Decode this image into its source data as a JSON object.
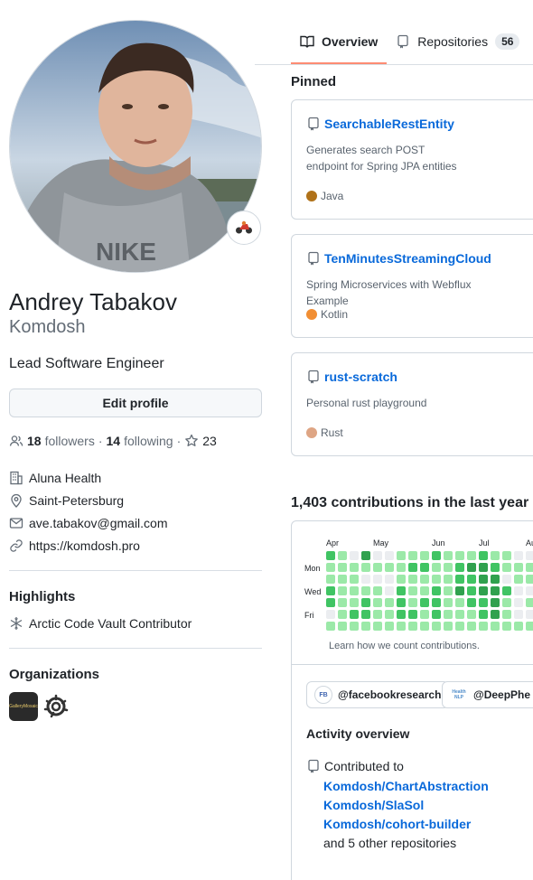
{
  "tabs": [
    {
      "label": "Overview",
      "icon": "book-icon",
      "active": true
    },
    {
      "label": "Repositories",
      "icon": "repo-icon",
      "count": "56"
    }
  ],
  "profile": {
    "name": "Andrey Tabakov",
    "login": "Komdosh",
    "bio": "Lead Software Engineer",
    "edit_label": "Edit profile",
    "followers_count": "18",
    "followers_label": "followers",
    "separator": "·",
    "following_count": "14",
    "following_label": "following",
    "stars_count": "23",
    "company": "Aluna Health",
    "location": "Saint-Petersburg",
    "email": "ave.tabakov@gmail.com",
    "website": "https://komdosh.pro"
  },
  "highlights": {
    "heading": "Highlights",
    "items": [
      "Arctic Code Vault Contributor"
    ]
  },
  "organizations": {
    "heading": "Organizations",
    "items": [
      {
        "name": "GalleryMosaic",
        "logo_text": "GalleryMosaic",
        "icon": "org-gallery-icon"
      },
      {
        "name": "grafana",
        "icon": "grafana-icon"
      }
    ]
  },
  "pinned": {
    "heading": "Pinned",
    "items": [
      {
        "name": "SearchableRestEntity",
        "description_lines": [
          "Generates search POST",
          "endpoint for Spring JPA entities"
        ],
        "language": "Java",
        "language_color": "#b07219"
      },
      {
        "name": "TenMinutesStreamingCloud",
        "description_lines": [
          "Spring Microservices with Webflux Example"
        ],
        "language": "Kotlin",
        "language_color": "#F18E33"
      },
      {
        "name": "rust-scratch",
        "description_lines": [
          "Personal rust playground"
        ],
        "language": "Rust",
        "language_color": "#dea584"
      }
    ]
  },
  "contributions": {
    "heading": "1,403 contributions in the last year",
    "months": [
      "Apr",
      "May",
      "Jun",
      "Jul",
      "Au"
    ],
    "weekdays": [
      "Mon",
      "Wed",
      "Fri"
    ],
    "levels": [
      [
        2,
        1,
        1,
        2,
        2,
        0
      ],
      [
        1,
        1,
        1,
        1,
        1,
        1
      ],
      [
        0,
        1,
        1,
        1,
        1,
        2
      ],
      [
        3,
        1,
        0,
        1,
        2,
        2
      ],
      [
        0,
        1,
        0,
        1,
        1,
        1
      ],
      [
        0,
        1,
        0,
        0,
        1,
        1
      ],
      [
        1,
        1,
        1,
        2,
        2,
        2
      ],
      [
        1,
        2,
        1,
        1,
        1,
        2
      ],
      [
        1,
        2,
        1,
        1,
        2,
        1
      ],
      [
        2,
        1,
        1,
        2,
        2,
        2
      ],
      [
        1,
        1,
        1,
        1,
        1,
        1
      ],
      [
        1,
        2,
        2,
        3,
        1,
        1
      ],
      [
        1,
        3,
        2,
        2,
        2,
        1
      ],
      [
        2,
        3,
        3,
        3,
        2,
        2
      ],
      [
        1,
        2,
        3,
        3,
        3,
        3
      ],
      [
        1,
        1,
        0,
        2,
        1,
        1
      ],
      [
        0,
        1,
        1,
        0,
        0,
        0
      ],
      [
        0,
        1,
        1,
        0,
        1,
        0
      ],
      [
        0,
        1,
        1,
        0,
        0,
        0
      ],
      [
        0,
        1,
        1,
        0,
        0,
        0
      ]
    ],
    "level_colors": [
      "#ebedf0",
      "#9be9a8",
      "#40c463",
      "#30a14e",
      "#216e39"
    ],
    "footer": "Learn how we count contributions."
  },
  "activity": {
    "orgs": [
      {
        "label": "@facebookresearch",
        "logo": "FB"
      },
      {
        "label": "@DeepPhe",
        "logo": "Health NLP"
      }
    ],
    "heading": "Activity overview",
    "contributed_label": "Contributed to",
    "repos": [
      "Komdosh/ChartAbstraction",
      "Komdosh/SlaSol",
      "Komdosh/cohort-builder"
    ],
    "others": "and 5 other repositories"
  }
}
